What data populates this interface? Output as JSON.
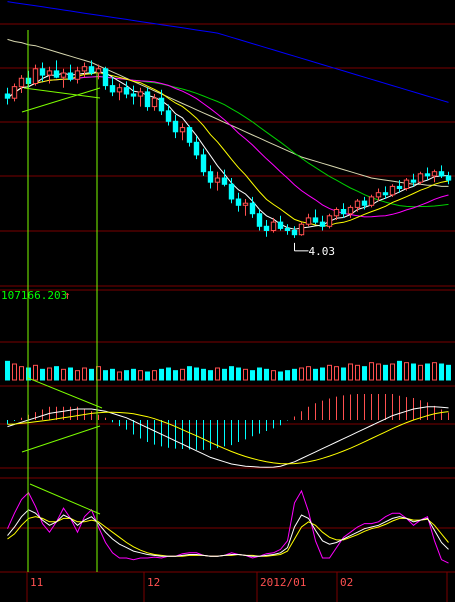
{
  "colors": {
    "background": "#000000",
    "up": "#ff5050",
    "down": "#00ffff",
    "grid": "#7a0000",
    "ma5": "#ffffff",
    "ma10": "#ffff00",
    "ma20": "#ff00ff",
    "ma30": "#00d000",
    "ma60": "#d8d8b0",
    "ma120": "#0000ff",
    "trend": "#7cfc00",
    "volume_label": "#00ff00",
    "macd_dif": "#ffffff",
    "macd_dea": "#ffff00",
    "kdj_k": "#ffffff",
    "kdj_d": "#ffff00",
    "kdj_j": "#ff00ff"
  },
  "chart_data": [
    {
      "type": "candlestick",
      "panel": "price",
      "x_axis_labels": [
        "11",
        "12",
        "2012/01",
        "02"
      ],
      "ylim": [
        3.6,
        6.2
      ],
      "annotations": [
        {
          "text": "4.03",
          "type": "low_marker",
          "value": 4.03
        }
      ],
      "candles": [
        [
          5.4,
          5.46,
          5.3,
          5.36
        ],
        [
          5.36,
          5.5,
          5.33,
          5.47
        ],
        [
          5.47,
          5.58,
          5.41,
          5.55
        ],
        [
          5.55,
          5.62,
          5.46,
          5.5
        ],
        [
          5.5,
          5.68,
          5.48,
          5.64
        ],
        [
          5.64,
          5.7,
          5.52,
          5.58
        ],
        [
          5.58,
          5.66,
          5.5,
          5.62
        ],
        [
          5.62,
          5.72,
          5.55,
          5.56
        ],
        [
          5.56,
          5.64,
          5.46,
          5.6
        ],
        [
          5.6,
          5.68,
          5.52,
          5.54
        ],
        [
          5.54,
          5.66,
          5.5,
          5.62
        ],
        [
          5.62,
          5.7,
          5.56,
          5.66
        ],
        [
          5.66,
          5.72,
          5.58,
          5.6
        ],
        [
          5.6,
          5.68,
          5.54,
          5.64
        ],
        [
          5.64,
          5.66,
          5.44,
          5.48
        ],
        [
          5.48,
          5.56,
          5.38,
          5.42
        ],
        [
          5.42,
          5.5,
          5.34,
          5.46
        ],
        [
          5.46,
          5.52,
          5.36,
          5.4
        ],
        [
          5.4,
          5.48,
          5.3,
          5.38
        ],
        [
          5.38,
          5.46,
          5.28,
          5.42
        ],
        [
          5.42,
          5.46,
          5.24,
          5.28
        ],
        [
          5.28,
          5.4,
          5.24,
          5.36
        ],
        [
          5.36,
          5.44,
          5.2,
          5.24
        ],
        [
          5.24,
          5.3,
          5.1,
          5.14
        ],
        [
          5.14,
          5.2,
          4.98,
          5.04
        ],
        [
          5.04,
          5.12,
          4.96,
          5.08
        ],
        [
          5.08,
          5.1,
          4.9,
          4.94
        ],
        [
          4.94,
          5.0,
          4.78,
          4.82
        ],
        [
          4.82,
          4.88,
          4.62,
          4.66
        ],
        [
          4.66,
          4.72,
          4.5,
          4.56
        ],
        [
          4.56,
          4.66,
          4.48,
          4.6
        ],
        [
          4.6,
          4.68,
          4.52,
          4.54
        ],
        [
          4.54,
          4.6,
          4.36,
          4.4
        ],
        [
          4.4,
          4.46,
          4.28,
          4.34
        ],
        [
          4.34,
          4.4,
          4.24,
          4.36
        ],
        [
          4.36,
          4.42,
          4.22,
          4.26
        ],
        [
          4.26,
          4.3,
          4.1,
          4.14
        ],
        [
          4.14,
          4.2,
          4.04,
          4.1
        ],
        [
          4.1,
          4.22,
          4.08,
          4.18
        ],
        [
          4.18,
          4.24,
          4.1,
          4.12
        ],
        [
          4.12,
          4.16,
          4.06,
          4.1
        ],
        [
          4.1,
          4.14,
          4.03,
          4.06
        ],
        [
          4.06,
          4.18,
          4.05,
          4.16
        ],
        [
          4.16,
          4.26,
          4.14,
          4.22
        ],
        [
          4.22,
          4.3,
          4.16,
          4.18
        ],
        [
          4.18,
          4.24,
          4.1,
          4.14
        ],
        [
          4.14,
          4.26,
          4.12,
          4.24
        ],
        [
          4.24,
          4.32,
          4.2,
          4.3
        ],
        [
          4.3,
          4.36,
          4.22,
          4.26
        ],
        [
          4.26,
          4.34,
          4.22,
          4.32
        ],
        [
          4.32,
          4.4,
          4.28,
          4.38
        ],
        [
          4.38,
          4.42,
          4.3,
          4.34
        ],
        [
          4.34,
          4.44,
          4.32,
          4.42
        ],
        [
          4.42,
          4.5,
          4.38,
          4.46
        ],
        [
          4.46,
          4.52,
          4.4,
          4.44
        ],
        [
          4.44,
          4.54,
          4.42,
          4.52
        ],
        [
          4.52,
          4.58,
          4.46,
          4.5
        ],
        [
          4.5,
          4.6,
          4.48,
          4.58
        ],
        [
          4.58,
          4.64,
          4.52,
          4.56
        ],
        [
          4.56,
          4.66,
          4.54,
          4.64
        ],
        [
          4.64,
          4.7,
          4.58,
          4.62
        ],
        [
          4.62,
          4.68,
          4.56,
          4.66
        ],
        [
          4.66,
          4.72,
          4.6,
          4.62
        ],
        [
          4.62,
          4.66,
          4.54,
          4.58
        ]
      ],
      "moving_averages": [
        {
          "name": "MA5",
          "period": 5
        },
        {
          "name": "MA10",
          "period": 10
        },
        {
          "name": "MA20",
          "period": 20
        },
        {
          "name": "MA30",
          "period": 30
        },
        {
          "name": "MA60",
          "period": 60,
          "values": [
            5.92,
            5.9,
            5.89,
            5.87,
            5.86,
            5.84,
            5.82,
            5.8,
            5.78,
            5.76,
            5.74,
            5.72,
            5.7,
            5.67,
            5.64,
            5.61,
            5.58,
            5.55,
            5.52,
            5.49,
            5.46,
            5.43,
            5.4,
            5.37,
            5.34,
            5.31,
            5.28,
            5.25,
            5.22,
            5.19,
            5.16,
            5.13,
            5.1,
            5.07,
            5.04,
            5.01,
            4.98,
            4.95,
            4.92,
            4.89,
            4.86,
            4.83,
            4.8,
            4.78,
            4.76,
            4.74,
            4.72,
            4.7,
            4.68,
            4.66,
            4.64,
            4.62,
            4.6,
            4.59,
            4.58,
            4.57,
            4.56,
            4.55,
            4.54,
            4.54,
            4.53,
            4.53,
            4.52,
            4.52
          ]
        },
        {
          "name": "MA120",
          "period": 120,
          "values": [
            6.28,
            6.27,
            6.26,
            6.25,
            6.24,
            6.23,
            6.22,
            6.21,
            6.2,
            6.19,
            6.18,
            6.17,
            6.16,
            6.15,
            6.14,
            6.13,
            6.12,
            6.11,
            6.1,
            6.09,
            6.08,
            6.07,
            6.06,
            6.05,
            6.04,
            6.03,
            6.02,
            6.01,
            6.0,
            5.99,
            5.98,
            5.96,
            5.94,
            5.92,
            5.9,
            5.88,
            5.86,
            5.84,
            5.82,
            5.8,
            5.78,
            5.76,
            5.74,
            5.72,
            5.7,
            5.68,
            5.66,
            5.64,
            5.62,
            5.6,
            5.58,
            5.56,
            5.54,
            5.52,
            5.5,
            5.48,
            5.46,
            5.44,
            5.42,
            5.4,
            5.38,
            5.36,
            5.34,
            5.32
          ]
        }
      ]
    },
    {
      "type": "bar",
      "panel": "volume",
      "label": "107166.203",
      "values": [
        14,
        12,
        10,
        9,
        11,
        8,
        9,
        10,
        8,
        9,
        7,
        9,
        8,
        10,
        7,
        8,
        6,
        7,
        8,
        7,
        6,
        7,
        8,
        9,
        7,
        8,
        10,
        9,
        8,
        7,
        9,
        8,
        10,
        9,
        8,
        7,
        9,
        8,
        7,
        6,
        7,
        8,
        9,
        10,
        8,
        9,
        11,
        10,
        9,
        12,
        11,
        10,
        13,
        12,
        11,
        12,
        14,
        13,
        12,
        11,
        12,
        13,
        12,
        11
      ]
    },
    {
      "type": "bar",
      "panel": "macd",
      "series": [
        {
          "name": "DIF",
          "values": [
            -0.03,
            -0.02,
            -0.01,
            0.0,
            0.01,
            0.02,
            0.03,
            0.035,
            0.04,
            0.045,
            0.05,
            0.05,
            0.05,
            0.045,
            0.04,
            0.03,
            0.02,
            0.01,
            -0.005,
            -0.02,
            -0.035,
            -0.05,
            -0.065,
            -0.08,
            -0.095,
            -0.11,
            -0.125,
            -0.14,
            -0.155,
            -0.17,
            -0.18,
            -0.19,
            -0.2,
            -0.205,
            -0.21,
            -0.212,
            -0.214,
            -0.215,
            -0.214,
            -0.21,
            -0.2,
            -0.19,
            -0.175,
            -0.16,
            -0.145,
            -0.13,
            -0.115,
            -0.1,
            -0.085,
            -0.07,
            -0.055,
            -0.04,
            -0.025,
            -0.01,
            0.005,
            0.02,
            0.03,
            0.04,
            0.05,
            0.055,
            0.06,
            0.06,
            0.058,
            0.055
          ]
        },
        {
          "name": "DEA",
          "values": [
            -0.02,
            -0.018,
            -0.015,
            -0.012,
            -0.008,
            -0.004,
            0.0,
            0.005,
            0.01,
            0.015,
            0.02,
            0.025,
            0.03,
            0.033,
            0.035,
            0.035,
            0.034,
            0.032,
            0.028,
            0.022,
            0.015,
            0.006,
            -0.005,
            -0.017,
            -0.03,
            -0.044,
            -0.058,
            -0.072,
            -0.087,
            -0.102,
            -0.116,
            -0.13,
            -0.143,
            -0.155,
            -0.166,
            -0.175,
            -0.183,
            -0.19,
            -0.195,
            -0.198,
            -0.199,
            -0.198,
            -0.195,
            -0.19,
            -0.183,
            -0.174,
            -0.164,
            -0.153,
            -0.141,
            -0.128,
            -0.114,
            -0.099,
            -0.084,
            -0.069,
            -0.054,
            -0.039,
            -0.025,
            -0.012,
            0.0,
            0.01,
            0.02,
            0.028,
            0.034,
            0.038
          ]
        }
      ]
    },
    {
      "type": "line",
      "panel": "kdj",
      "ylim": [
        0,
        100
      ],
      "series": [
        {
          "name": "K",
          "values": [
            40,
            50,
            62,
            70,
            66,
            58,
            52,
            56,
            64,
            60,
            52,
            58,
            62,
            54,
            44,
            36,
            30,
            26,
            22,
            20,
            18,
            17,
            16,
            16,
            16,
            17,
            18,
            18,
            17,
            16,
            16,
            17,
            18,
            18,
            17,
            16,
            16,
            17,
            18,
            20,
            26,
            50,
            64,
            60,
            46,
            34,
            30,
            32,
            36,
            40,
            44,
            48,
            50,
            52,
            56,
            60,
            62,
            60,
            56,
            58,
            60,
            46,
            32,
            24
          ]
        },
        {
          "name": "D",
          "values": [
            36,
            42,
            52,
            60,
            62,
            60,
            56,
            56,
            60,
            60,
            56,
            56,
            58,
            56,
            50,
            44,
            38,
            32,
            27,
            23,
            20,
            18,
            17,
            16,
            16,
            16,
            17,
            17,
            17,
            16,
            16,
            17,
            17,
            18,
            17,
            17,
            16,
            16,
            17,
            18,
            22,
            36,
            50,
            56,
            52,
            44,
            38,
            35,
            35,
            38,
            41,
            45,
            48,
            50,
            53,
            57,
            60,
            60,
            58,
            58,
            59,
            52,
            42,
            32
          ]
        },
        {
          "name": "J",
          "values": [
            48,
            66,
            82,
            90,
            74,
            54,
            44,
            56,
            72,
            60,
            44,
            62,
            70,
            50,
            32,
            20,
            14,
            14,
            12,
            14,
            14,
            15,
            14,
            16,
            16,
            19,
            20,
            20,
            17,
            16,
            16,
            17,
            20,
            18,
            17,
            14,
            16,
            19,
            20,
            24,
            34,
            78,
            92,
            68,
            34,
            14,
            14,
            26,
            38,
            44,
            50,
            54,
            54,
            56,
            62,
            66,
            66,
            60,
            52,
            58,
            62,
            34,
            12,
            8
          ]
        }
      ]
    }
  ]
}
